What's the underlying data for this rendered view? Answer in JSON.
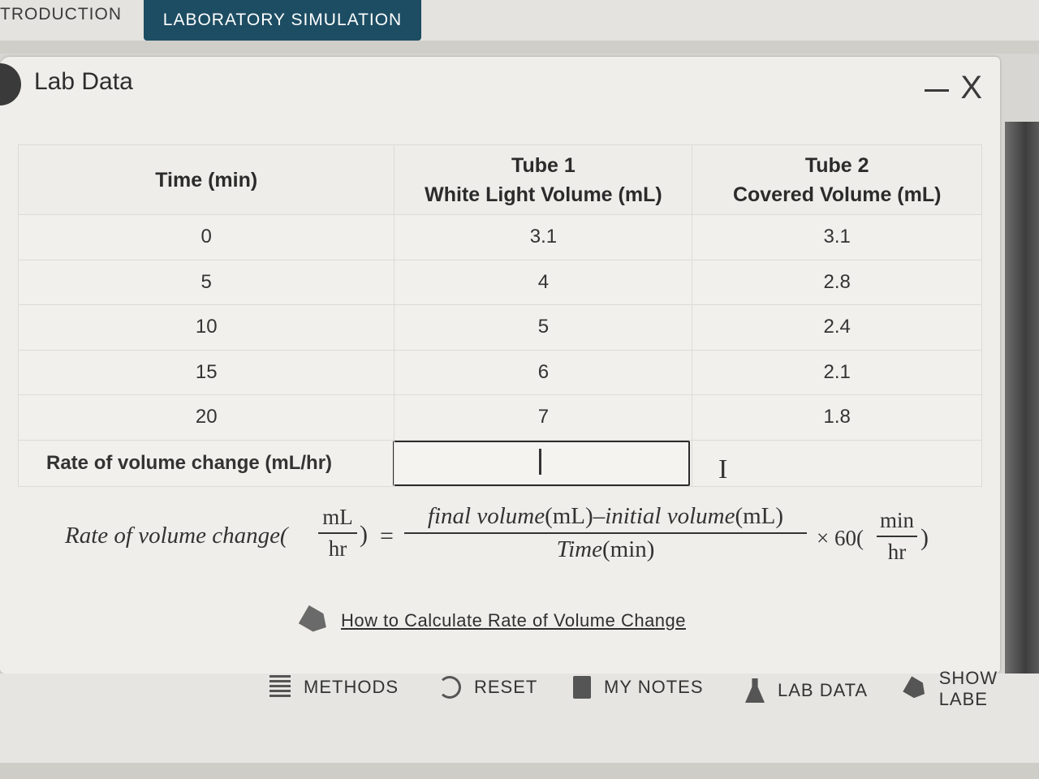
{
  "tabs": {
    "introduction": "TRODUCTION",
    "simulation": "LABORATORY SIMULATION"
  },
  "panel": {
    "title": "Lab Data",
    "minimize": "–",
    "close": "X"
  },
  "table": {
    "headers": {
      "time": "Time (min)",
      "tube1_line1": "Tube 1",
      "tube1_line2": "White Light Volume (mL)",
      "tube2_line1": "Tube 2",
      "tube2_line2": "Covered Volume (mL)"
    },
    "rows": [
      {
        "time": "0",
        "tube1": "3.1",
        "tube2": "3.1"
      },
      {
        "time": "5",
        "tube1": "4",
        "tube2": "2.8"
      },
      {
        "time": "10",
        "tube1": "5",
        "tube2": "2.4"
      },
      {
        "time": "15",
        "tube1": "6",
        "tube2": "2.1"
      },
      {
        "time": "20",
        "tube1": "7",
        "tube2": "1.8"
      }
    ],
    "rate_label": "Rate of volume change (mL/hr)",
    "rate_input_value": ""
  },
  "formula": {
    "lhs": "Rate of volume change(",
    "lhs_num": "mL",
    "lhs_den": "hr",
    "paren_close": ")",
    "equals": "=",
    "num_final": "final volume",
    "num_unit1": "(mL)",
    "num_minus": "–",
    "num_initial": "initial volume",
    "num_unit2": "(mL)",
    "den_time": "Time",
    "den_unit": "(min)",
    "times": "× 60(",
    "rhs_num": "min",
    "rhs_den": "hr",
    "rhs_paren_close": ")"
  },
  "help": {
    "link_text": "How to Calculate Rate of Volume Change",
    "icon": "tag-icon"
  },
  "toolbar": {
    "methods": "METHODS",
    "reset": "RESET",
    "notes": "MY NOTES",
    "lab_data": "LAB DATA",
    "show_labels": "SHOW LABE"
  }
}
